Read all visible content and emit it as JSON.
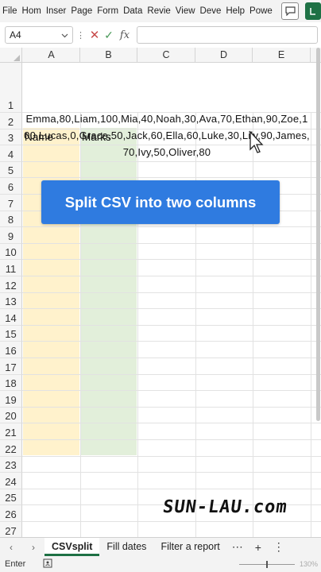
{
  "ribbon": {
    "tabs": [
      "File",
      "Hom",
      "Inser",
      "Page",
      "Form",
      "Data",
      "Revie",
      "View",
      "Deve",
      "Help",
      "Powe"
    ]
  },
  "formula_bar": {
    "name_box": "A4",
    "fx_label": "fx",
    "value": ""
  },
  "columns": [
    "A",
    "B",
    "C",
    "D",
    "E"
  ],
  "rows": [
    "1",
    "2",
    "3",
    "4",
    "5",
    "6",
    "7",
    "8",
    "9",
    "10",
    "11",
    "12",
    "13",
    "14",
    "15",
    "16",
    "17",
    "18",
    "19",
    "20",
    "21",
    "22",
    "23",
    "24",
    "25",
    "26",
    "27"
  ],
  "cells": {
    "A1": "Emma,80,Liam,100,Mia,40,Noah,30,Ava,70,Ethan,90,Zoe,100,Lucas,0,Grace,50,Jack,60,Ella,60,Luke,30,Lily,90,James,70,Ivy,50,Oliver,80",
    "A3": "Name",
    "B3": "Marks"
  },
  "colors": {
    "name_column_fill": "#fff2cc",
    "marks_column_fill": "#e2efda",
    "banner": "#2f7be0",
    "accent": "#1e7145"
  },
  "banner": {
    "text": "Split CSV into two columns"
  },
  "watermark": {
    "text": "SUN-LAU.com"
  },
  "sheet_tabs": [
    "CSVsplit",
    "Fill dates",
    "Filter a report"
  ],
  "active_sheet": "CSVsplit",
  "status": {
    "mode": "Enter",
    "zoom": "130%"
  },
  "icons": [
    "comment-icon",
    "share-icon",
    "dropdown-arrow-icon",
    "cancel-x-icon",
    "confirm-check-icon",
    "fx-icon",
    "mouse-cursor-icon",
    "tab-left-arrow-icon",
    "tab-right-arrow-icon",
    "more-icon",
    "add-sheet-icon",
    "accessibility-icon"
  ]
}
